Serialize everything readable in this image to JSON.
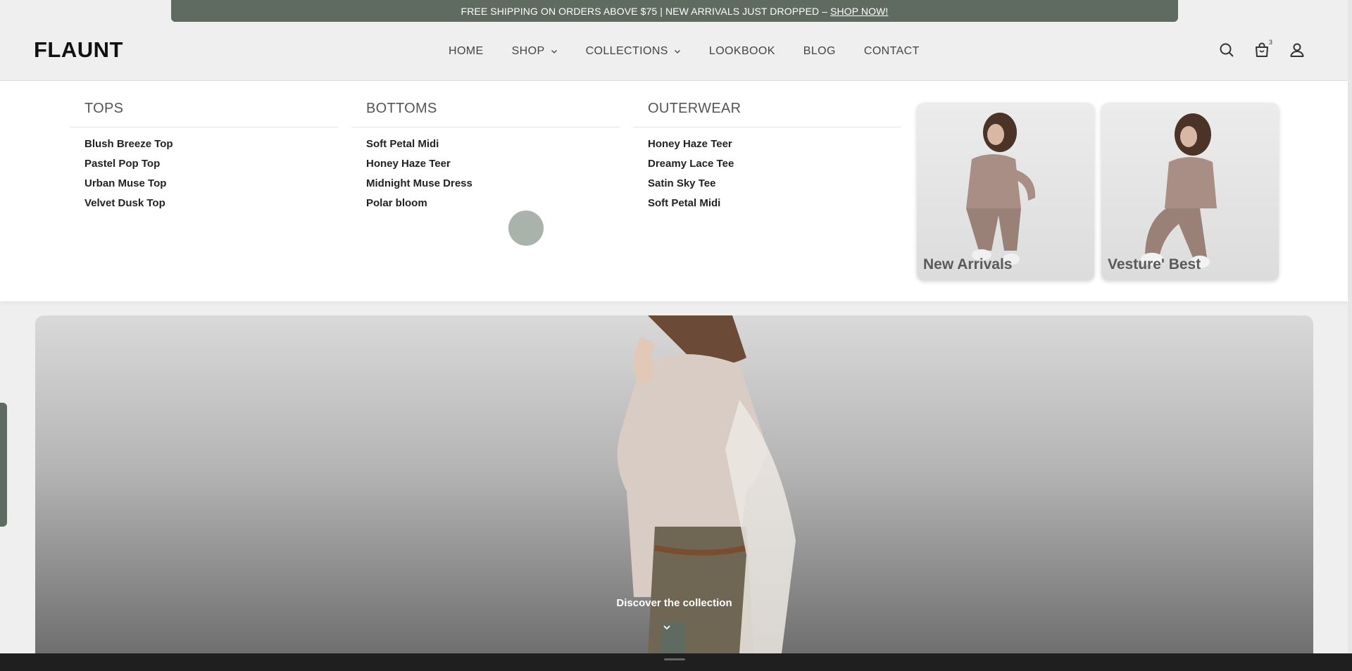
{
  "announcement": {
    "text": "FREE SHIPPING ON ORDERS ABOVE $75 | NEW ARRIVALS JUST DROPPED –",
    "link": "SHOP NOW!"
  },
  "header": {
    "logo": "FLAUNT",
    "nav": [
      {
        "label": "HOME"
      },
      {
        "label": "SHOP",
        "dropdown": true
      },
      {
        "label": "COLLECTIONS",
        "dropdown": true
      },
      {
        "label": "LOOKBOOK"
      },
      {
        "label": "BLOG"
      },
      {
        "label": "CONTACT"
      }
    ],
    "cart_count": "3",
    "icons": [
      "search-icon",
      "cart-icon",
      "account-icon"
    ]
  },
  "mega_menu": {
    "columns": [
      {
        "title": "TOPS",
        "items": [
          "Blush Breeze Top",
          "Pastel Pop Top",
          "Urban Muse Top",
          "Velvet Dusk Top"
        ]
      },
      {
        "title": "BOTTOMS",
        "items": [
          "Soft Petal Midi",
          "Honey Haze Teer",
          "Midnight Muse Dress",
          "Polar bloom"
        ]
      },
      {
        "title": "OUTERWEAR",
        "items": [
          "Honey Haze Teer",
          "Dreamy Lace Tee",
          "Satin Sky Tee",
          "Soft Petal Midi"
        ]
      }
    ],
    "promos": [
      {
        "label": "New Arrivals"
      },
      {
        "label": "Vesture' Best"
      }
    ]
  },
  "hero": {
    "cta": "Discover the collection"
  },
  "colors": {
    "accent": "#5f6a60",
    "background": "#efefef"
  }
}
